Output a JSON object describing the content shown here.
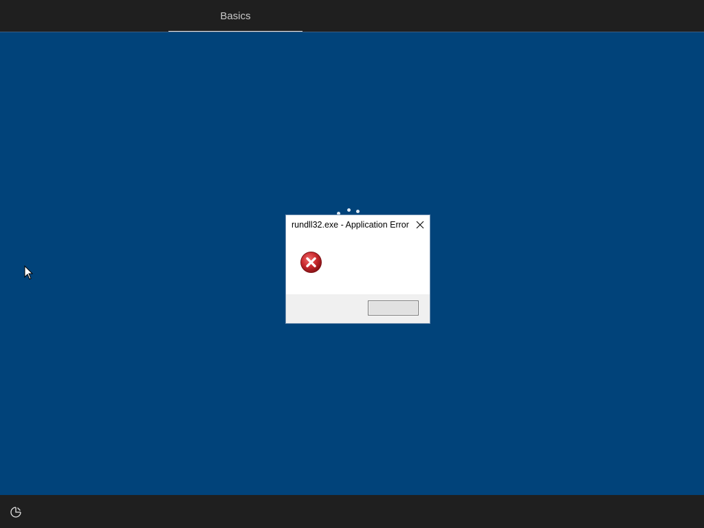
{
  "header": {
    "tab_label": "Basics"
  },
  "dialog": {
    "title": "rundll32.exe - Application Error",
    "close_icon": "close-icon",
    "status_icon": "error-icon",
    "ok_label": ""
  },
  "footer": {
    "icon": "accessibility-icon"
  },
  "colors": {
    "background": "#01437a",
    "bars": "#1f1f1f",
    "error_red": "#c8282d"
  }
}
